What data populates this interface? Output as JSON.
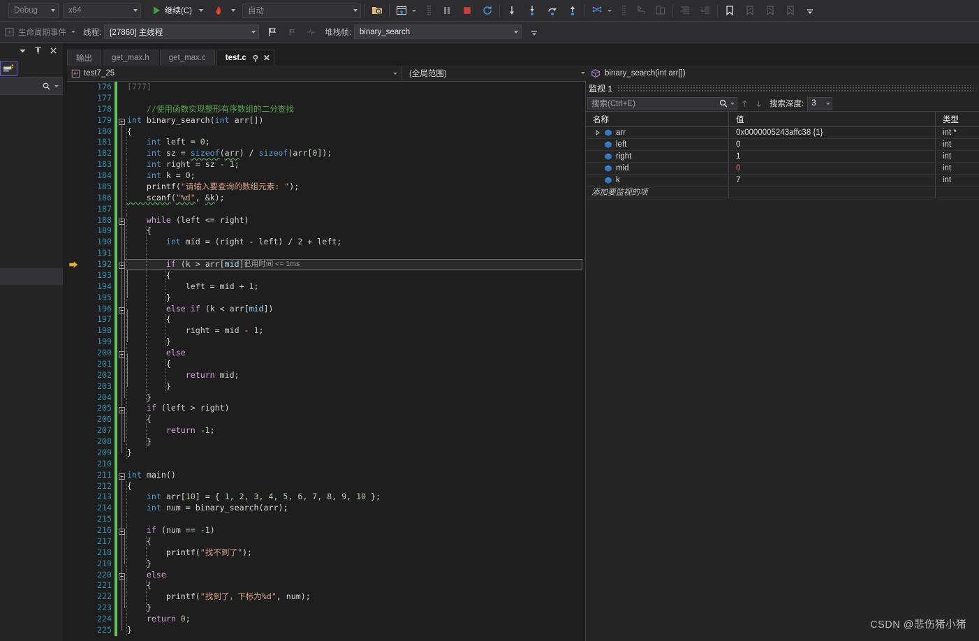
{
  "toolbar_row1": {
    "config_combo": "Debug",
    "platform_combo": "x64",
    "continue_label": "继续(C)",
    "exception_label": "",
    "attach_combo": "自动",
    "icons": [
      "folder-search-icon",
      "window-layout-icon",
      "breakpoints-icon",
      "pause-icon",
      "stop-icon",
      "restart-icon",
      "step-into-icon",
      "step-over-icon",
      "step-out-icon",
      "show-next-statement-icon",
      "threads-icon",
      "parallel-stacks-icon",
      "tasks-icon",
      "indent-icon",
      "outdent-icon",
      "bookmark-toggle-icon",
      "bookmark-prev-icon",
      "bookmark-next-icon",
      "bookmark-clear-icon"
    ]
  },
  "toolbar_row2": {
    "lifecycle_events_label": "生命周期事件",
    "thread_label": "线程:",
    "thread_combo": "[27860] 主线程",
    "stackframe_label": "堆栈帧:",
    "stackframe_combo": "binary_search"
  },
  "left_panel": {
    "header_icons": [
      "chevron-down-icon",
      "pin-icon",
      "close-icon"
    ],
    "search_icon": "search-icon"
  },
  "editor": {
    "tabs": [
      {
        "label": "输出",
        "active": false
      },
      {
        "label": "get_max.h",
        "active": false
      },
      {
        "label": "get_max.c",
        "active": false
      },
      {
        "label": "test.c",
        "active": true,
        "pin": "⚲",
        "close": "✕"
      }
    ],
    "navbar": {
      "project": "test7_25",
      "scope": "(全局范围)",
      "member": "binary_search(int arr[])"
    },
    "current_line": 192,
    "current_line_tip": "已用时间 <= 1ms",
    "first_line": 176,
    "lines": [
      {
        "n": 176,
        "tokens": [
          {
            "t": "[777]",
            "c": "pp"
          }
        ],
        "indent": 0,
        "partial": true
      },
      {
        "n": 177,
        "tokens": []
      },
      {
        "n": 178,
        "tokens": [
          {
            "t": "    //使用函数实现整形有序数组的二分查找",
            "c": "cm"
          }
        ]
      },
      {
        "n": 179,
        "fold": true,
        "tokens": [
          {
            "t": "int ",
            "c": "k"
          },
          {
            "t": "binary_search",
            "c": "fname"
          },
          {
            "t": "(",
            "c": "op"
          },
          {
            "t": "int ",
            "c": "k"
          },
          {
            "t": "arr",
            "c": "var"
          },
          {
            "t": "[])",
            "c": "op"
          }
        ]
      },
      {
        "n": 180,
        "tokens": [
          {
            "t": "{",
            "c": "op"
          }
        ],
        "indent": 1
      },
      {
        "n": 181,
        "tokens": [
          {
            "t": "    int ",
            "c": "k"
          },
          {
            "t": "left",
            "c": "var"
          },
          {
            "t": " = ",
            "c": "op"
          },
          {
            "t": "0",
            "c": "num"
          },
          {
            "t": ";",
            "c": "op"
          }
        ],
        "indent": 1
      },
      {
        "n": 182,
        "tokens": [
          {
            "t": "    int ",
            "c": "k"
          },
          {
            "t": "sz",
            "c": "var"
          },
          {
            "t": " = ",
            "c": "op"
          },
          {
            "t": "sizeof",
            "c": "k sq"
          },
          {
            "t": "(",
            "c": "op"
          },
          {
            "t": "arr",
            "c": "var sq"
          },
          {
            "t": ") / ",
            "c": "op"
          },
          {
            "t": "sizeof",
            "c": "k"
          },
          {
            "t": "(",
            "c": "op"
          },
          {
            "t": "arr",
            "c": "var"
          },
          {
            "t": "[",
            "c": "op"
          },
          {
            "t": "0",
            "c": "num"
          },
          {
            "t": "]);",
            "c": "op"
          }
        ],
        "indent": 1
      },
      {
        "n": 183,
        "tokens": [
          {
            "t": "    int ",
            "c": "k"
          },
          {
            "t": "right",
            "c": "var"
          },
          {
            "t": " = ",
            "c": "op"
          },
          {
            "t": "sz",
            "c": "var"
          },
          {
            "t": " - ",
            "c": "op"
          },
          {
            "t": "1",
            "c": "num"
          },
          {
            "t": ";",
            "c": "op"
          }
        ],
        "indent": 1
      },
      {
        "n": 184,
        "tokens": [
          {
            "t": "    int ",
            "c": "k"
          },
          {
            "t": "k",
            "c": "var"
          },
          {
            "t": " = ",
            "c": "op"
          },
          {
            "t": "0",
            "c": "num"
          },
          {
            "t": ";",
            "c": "op"
          }
        ],
        "indent": 1
      },
      {
        "n": 185,
        "tokens": [
          {
            "t": "    printf",
            "c": "fname"
          },
          {
            "t": "(",
            "c": "op"
          },
          {
            "t": "\"请输入要查询的数组元素: \"",
            "c": "str"
          },
          {
            "t": ");",
            "c": "op"
          }
        ],
        "indent": 1
      },
      {
        "n": 186,
        "tokens": [
          {
            "t": "    scanf",
            "c": "fname sq"
          },
          {
            "t": "(",
            "c": "op"
          },
          {
            "t": "\"%d\"",
            "c": "str sq"
          },
          {
            "t": ", ",
            "c": "op"
          },
          {
            "t": "&k",
            "c": "var sq"
          },
          {
            "t": ");",
            "c": "op"
          }
        ],
        "indent": 1
      },
      {
        "n": 187,
        "tokens": [],
        "indent": 1
      },
      {
        "n": 188,
        "fold": true,
        "tokens": [
          {
            "t": "    while ",
            "c": "kc"
          },
          {
            "t": "(",
            "c": "op"
          },
          {
            "t": "left",
            "c": "var"
          },
          {
            "t": " <= ",
            "c": "op"
          },
          {
            "t": "right",
            "c": "var"
          },
          {
            "t": ")",
            "c": "op"
          }
        ],
        "indent": 1
      },
      {
        "n": 189,
        "tokens": [
          {
            "t": "    {",
            "c": "op"
          }
        ],
        "indent": 2
      },
      {
        "n": 190,
        "tokens": [
          {
            "t": "        int ",
            "c": "k"
          },
          {
            "t": "mid",
            "c": "var"
          },
          {
            "t": " = (",
            "c": "op"
          },
          {
            "t": "right",
            "c": "var"
          },
          {
            "t": " - ",
            "c": "op"
          },
          {
            "t": "left",
            "c": "var"
          },
          {
            "t": ") / ",
            "c": "op"
          },
          {
            "t": "2",
            "c": "num"
          },
          {
            "t": " + ",
            "c": "op"
          },
          {
            "t": "left",
            "c": "var"
          },
          {
            "t": ";",
            "c": "op"
          }
        ],
        "indent": 2
      },
      {
        "n": 191,
        "tokens": [],
        "indent": 2
      },
      {
        "n": 192,
        "fold": true,
        "current": true,
        "tokens": [
          {
            "t": "        if ",
            "c": "kc"
          },
          {
            "t": "(",
            "c": "op"
          },
          {
            "t": "k",
            "c": "var"
          },
          {
            "t": " > ",
            "c": "op"
          },
          {
            "t": "arr",
            "c": "var"
          },
          {
            "t": "[",
            "c": "op"
          },
          {
            "t": "mid",
            "c": "id"
          },
          {
            "t": "])",
            "c": "op"
          }
        ],
        "indent": 2
      },
      {
        "n": 193,
        "tokens": [
          {
            "t": "        {",
            "c": "op"
          }
        ],
        "indent": 3
      },
      {
        "n": 194,
        "tokens": [
          {
            "t": "            left",
            "c": "var"
          },
          {
            "t": " = ",
            "c": "op"
          },
          {
            "t": "mid",
            "c": "var"
          },
          {
            "t": " + ",
            "c": "op"
          },
          {
            "t": "1",
            "c": "num"
          },
          {
            "t": ";",
            "c": "op"
          }
        ],
        "indent": 3
      },
      {
        "n": 195,
        "tokens": [
          {
            "t": "        }",
            "c": "op"
          }
        ],
        "indent": 3
      },
      {
        "n": 196,
        "fold": true,
        "tokens": [
          {
            "t": "        else if ",
            "c": "kc"
          },
          {
            "t": "(",
            "c": "op"
          },
          {
            "t": "k",
            "c": "var"
          },
          {
            "t": " < ",
            "c": "op"
          },
          {
            "t": "arr",
            "c": "var"
          },
          {
            "t": "[",
            "c": "op"
          },
          {
            "t": "mid",
            "c": "id"
          },
          {
            "t": "])",
            "c": "op"
          }
        ],
        "indent": 2
      },
      {
        "n": 197,
        "tokens": [
          {
            "t": "        {",
            "c": "op"
          }
        ],
        "indent": 3
      },
      {
        "n": 198,
        "tokens": [
          {
            "t": "            right",
            "c": "var"
          },
          {
            "t": " = ",
            "c": "op"
          },
          {
            "t": "mid",
            "c": "var"
          },
          {
            "t": " - ",
            "c": "op"
          },
          {
            "t": "1",
            "c": "num"
          },
          {
            "t": ";",
            "c": "op"
          }
        ],
        "indent": 3
      },
      {
        "n": 199,
        "tokens": [
          {
            "t": "        }",
            "c": "op"
          }
        ],
        "indent": 3
      },
      {
        "n": 200,
        "fold": true,
        "tokens": [
          {
            "t": "        else",
            "c": "kc"
          }
        ],
        "indent": 2
      },
      {
        "n": 201,
        "tokens": [
          {
            "t": "        {",
            "c": "op"
          }
        ],
        "indent": 3
      },
      {
        "n": 202,
        "tokens": [
          {
            "t": "            return ",
            "c": "kc"
          },
          {
            "t": "mid",
            "c": "var"
          },
          {
            "t": ";",
            "c": "op"
          }
        ],
        "indent": 3
      },
      {
        "n": 203,
        "tokens": [
          {
            "t": "        }",
            "c": "op"
          }
        ],
        "indent": 3
      },
      {
        "n": 204,
        "tokens": [
          {
            "t": "    }",
            "c": "op"
          }
        ],
        "indent": 2
      },
      {
        "n": 205,
        "fold": true,
        "tokens": [
          {
            "t": "    if ",
            "c": "kc"
          },
          {
            "t": "(",
            "c": "op"
          },
          {
            "t": "left",
            "c": "var"
          },
          {
            "t": " > ",
            "c": "op"
          },
          {
            "t": "right",
            "c": "var"
          },
          {
            "t": ")",
            "c": "op"
          }
        ],
        "indent": 1
      },
      {
        "n": 206,
        "tokens": [
          {
            "t": "    {",
            "c": "op"
          }
        ],
        "indent": 2
      },
      {
        "n": 207,
        "tokens": [
          {
            "t": "        return ",
            "c": "kc"
          },
          {
            "t": "-1",
            "c": "num"
          },
          {
            "t": ";",
            "c": "op"
          }
        ],
        "indent": 2
      },
      {
        "n": 208,
        "tokens": [
          {
            "t": "    }",
            "c": "op"
          }
        ],
        "indent": 2
      },
      {
        "n": 209,
        "tokens": [
          {
            "t": "}",
            "c": "op"
          }
        ],
        "indent": 1
      },
      {
        "n": 210,
        "tokens": []
      },
      {
        "n": 211,
        "fold": true,
        "tokens": [
          {
            "t": "int ",
            "c": "k"
          },
          {
            "t": "main",
            "c": "fname"
          },
          {
            "t": "()",
            "c": "op"
          }
        ]
      },
      {
        "n": 212,
        "tokens": [
          {
            "t": "{",
            "c": "op"
          }
        ],
        "indent": 1
      },
      {
        "n": 213,
        "tokens": [
          {
            "t": "    int ",
            "c": "k"
          },
          {
            "t": "arr",
            "c": "var"
          },
          {
            "t": "[",
            "c": "op"
          },
          {
            "t": "10",
            "c": "num"
          },
          {
            "t": "] = { ",
            "c": "op"
          },
          {
            "t": "1, 2, 3, 4, 5, 6, 7, 8, 9, 10",
            "c": "num"
          },
          {
            "t": " };",
            "c": "op"
          }
        ],
        "indent": 1
      },
      {
        "n": 214,
        "tokens": [
          {
            "t": "    int ",
            "c": "k"
          },
          {
            "t": "num",
            "c": "var"
          },
          {
            "t": " = ",
            "c": "op"
          },
          {
            "t": "binary_search",
            "c": "fname"
          },
          {
            "t": "(",
            "c": "op"
          },
          {
            "t": "arr",
            "c": "var"
          },
          {
            "t": ");",
            "c": "op"
          }
        ],
        "indent": 1
      },
      {
        "n": 215,
        "tokens": [],
        "indent": 1
      },
      {
        "n": 216,
        "fold": true,
        "tokens": [
          {
            "t": "    if ",
            "c": "kc"
          },
          {
            "t": "(",
            "c": "op"
          },
          {
            "t": "num",
            "c": "var"
          },
          {
            "t": " == ",
            "c": "op"
          },
          {
            "t": "-1",
            "c": "num"
          },
          {
            "t": ")",
            "c": "op"
          }
        ],
        "indent": 1
      },
      {
        "n": 217,
        "tokens": [
          {
            "t": "    {",
            "c": "op"
          }
        ],
        "indent": 2
      },
      {
        "n": 218,
        "tokens": [
          {
            "t": "        printf",
            "c": "fname"
          },
          {
            "t": "(",
            "c": "op"
          },
          {
            "t": "\"找不到了\"",
            "c": "str"
          },
          {
            "t": ");",
            "c": "op"
          }
        ],
        "indent": 2
      },
      {
        "n": 219,
        "tokens": [
          {
            "t": "    }",
            "c": "op"
          }
        ],
        "indent": 2
      },
      {
        "n": 220,
        "fold": true,
        "tokens": [
          {
            "t": "    else",
            "c": "kc"
          }
        ],
        "indent": 1
      },
      {
        "n": 221,
        "tokens": [
          {
            "t": "    {",
            "c": "op"
          }
        ],
        "indent": 2
      },
      {
        "n": 222,
        "tokens": [
          {
            "t": "        printf",
            "c": "fname"
          },
          {
            "t": "(",
            "c": "op"
          },
          {
            "t": "\"找到了，下标为%d\"",
            "c": "str"
          },
          {
            "t": ", ",
            "c": "op"
          },
          {
            "t": "num",
            "c": "var"
          },
          {
            "t": ");",
            "c": "op"
          }
        ],
        "indent": 2
      },
      {
        "n": 223,
        "tokens": [
          {
            "t": "    }",
            "c": "op"
          }
        ],
        "indent": 2
      },
      {
        "n": 224,
        "tokens": [
          {
            "t": "    return ",
            "c": "kc"
          },
          {
            "t": "0",
            "c": "num"
          },
          {
            "t": ";",
            "c": "op"
          }
        ],
        "indent": 1
      },
      {
        "n": 225,
        "tokens": [
          {
            "t": "}",
            "c": "op"
          }
        ],
        "indent": 1
      }
    ]
  },
  "watch": {
    "title": "监视 1",
    "search_placeholder": "搜索(Ctrl+E)",
    "depth_label": "搜索深度:",
    "depth_value": "3",
    "columns": [
      "名称",
      "值",
      "类型"
    ],
    "rows": [
      {
        "name": "arr",
        "value": "0x0000005243affc38 {1}",
        "type": "int *",
        "expandable": true,
        "changed": false
      },
      {
        "name": "left",
        "value": "0",
        "type": "int",
        "expandable": false,
        "changed": false
      },
      {
        "name": "right",
        "value": "1",
        "type": "int",
        "expandable": false,
        "changed": false
      },
      {
        "name": "mid",
        "value": "0",
        "type": "int",
        "expandable": false,
        "changed": true
      },
      {
        "name": "k",
        "value": "7",
        "type": "int",
        "expandable": false,
        "changed": false
      }
    ],
    "add_item_placeholder": "添加要监视的项"
  },
  "watermark": "CSDN @悲伤猪小猪",
  "colors": {
    "accent_blue": "#2b91af",
    "keyword": "#569cd6",
    "control": "#d8a0df",
    "comment": "#57a64a",
    "string": "#d69d85",
    "number": "#b5cea8",
    "changed_value": "#e06c6c",
    "changebar_green": "#62c462",
    "stop_red": "#c64040",
    "current_arrow": "#e8b33a"
  }
}
